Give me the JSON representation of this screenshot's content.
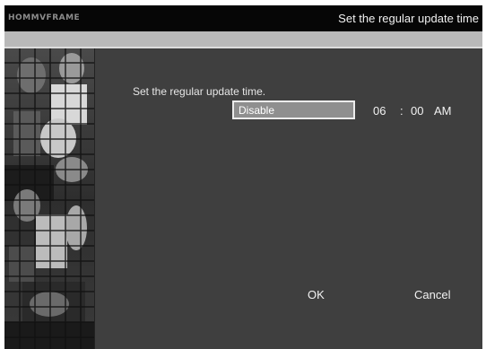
{
  "header": {
    "brand": "HOMMVFRAME",
    "title": "Set the regular update time"
  },
  "form": {
    "prompt": "Set the regular update time.",
    "mode_value": "Disable",
    "hour": "06",
    "separator": ":",
    "minute": "00",
    "period": "AM"
  },
  "actions": {
    "ok_label": "OK",
    "cancel_label": "Cancel"
  },
  "colors": {
    "background": "#3f3f3f",
    "title_bar": "#060606",
    "divider_bar": "#b9b9b9",
    "selected_field": "#8f8f8f"
  },
  "icons": {
    "side_image": "wedding-photo-collage"
  }
}
